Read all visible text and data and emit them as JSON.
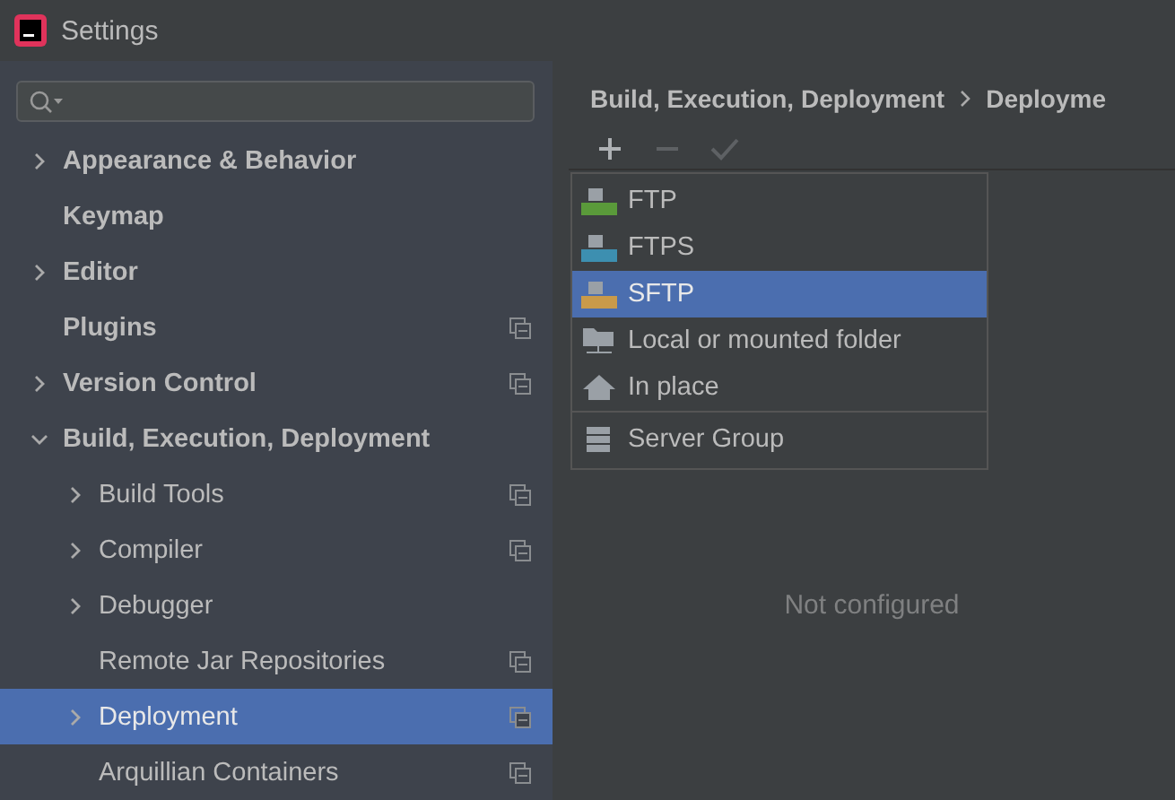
{
  "window": {
    "title": "Settings"
  },
  "sidebar": {
    "items": [
      {
        "label": "Appearance & Behavior",
        "kind": "group",
        "expanded": false,
        "selected": false,
        "project_level": false
      },
      {
        "label": "Keymap",
        "kind": "leaf",
        "selected": false,
        "project_level": false
      },
      {
        "label": "Editor",
        "kind": "group",
        "expanded": false,
        "selected": false,
        "project_level": false
      },
      {
        "label": "Plugins",
        "kind": "leaf",
        "selected": false,
        "project_level": true
      },
      {
        "label": "Version Control",
        "kind": "group",
        "expanded": false,
        "selected": false,
        "project_level": true
      },
      {
        "label": "Build, Execution, Deployment",
        "kind": "group",
        "expanded": true,
        "selected": false,
        "project_level": false,
        "children": [
          {
            "label": "Build Tools",
            "kind": "group",
            "expanded": false,
            "selected": false,
            "project_level": true
          },
          {
            "label": "Compiler",
            "kind": "group",
            "expanded": false,
            "selected": false,
            "project_level": true
          },
          {
            "label": "Debugger",
            "kind": "group",
            "expanded": false,
            "selected": false,
            "project_level": false
          },
          {
            "label": "Remote Jar Repositories",
            "kind": "leaf",
            "selected": false,
            "project_level": true
          },
          {
            "label": "Deployment",
            "kind": "group",
            "expanded": false,
            "selected": true,
            "project_level": true
          },
          {
            "label": "Arquillian Containers",
            "kind": "leaf",
            "selected": false,
            "project_level": true
          }
        ]
      }
    ]
  },
  "breadcrumb": [
    "Build, Execution, Deployment",
    "Deployme"
  ],
  "toolbar": [
    {
      "kind": "add",
      "disabled": false
    },
    {
      "kind": "remove",
      "disabled": true
    },
    {
      "kind": "apply",
      "disabled": true
    }
  ],
  "menu": {
    "items": [
      {
        "label": "FTP",
        "kind": "ftp",
        "selected": false,
        "separator_before": false
      },
      {
        "label": "FTPS",
        "kind": "ftps",
        "selected": false,
        "separator_before": false
      },
      {
        "label": "SFTP",
        "kind": "sftp",
        "selected": true,
        "separator_before": false
      },
      {
        "label": "Local or mounted folder",
        "kind": "folder",
        "selected": false,
        "separator_before": false
      },
      {
        "label": "In place",
        "kind": "home",
        "selected": false,
        "separator_before": false
      },
      {
        "label": "Server Group",
        "kind": "group",
        "selected": false,
        "separator_before": true
      }
    ]
  },
  "empty_text": "Not configured"
}
